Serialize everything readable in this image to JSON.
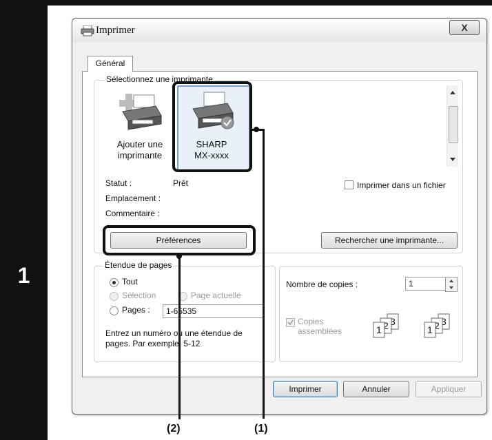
{
  "step": {
    "number": "1"
  },
  "dialog": {
    "title": "Imprimer",
    "close_label": "X",
    "tab_general": "Général",
    "select_printer_legend": "Sélectionnez une imprimante",
    "printers": [
      {
        "label_line1": "Ajouter une",
        "label_line2": "imprimante"
      },
      {
        "label_line1": "SHARP",
        "label_line2": "MX-xxxx"
      }
    ],
    "status_label": "Statut :",
    "status_value": "Prêt",
    "location_label": "Emplacement :",
    "comment_label": "Commentaire :",
    "print_to_file_label": "Imprimer dans un fichier",
    "preferences_button": "Préférences",
    "find_printer_button": "Rechercher une imprimante...",
    "page_range": {
      "legend": "Étendue de pages",
      "all": "Tout",
      "selection": "Sélection",
      "current_page": "Page actuelle",
      "pages": "Pages :",
      "pages_value": "1-65535",
      "hint": "Entrez un numéro ou une étendue de pages. Par exemple, 5-12"
    },
    "copies": {
      "label": "Nombre de copies :",
      "value": "1",
      "collate_label_line1": "Copies",
      "collate_label_line2": "assemblées"
    },
    "buttons": {
      "print": "Imprimer",
      "cancel": "Annuler",
      "apply": "Appliquer"
    }
  },
  "callouts": {
    "one": "(1)",
    "two": "(2)"
  }
}
